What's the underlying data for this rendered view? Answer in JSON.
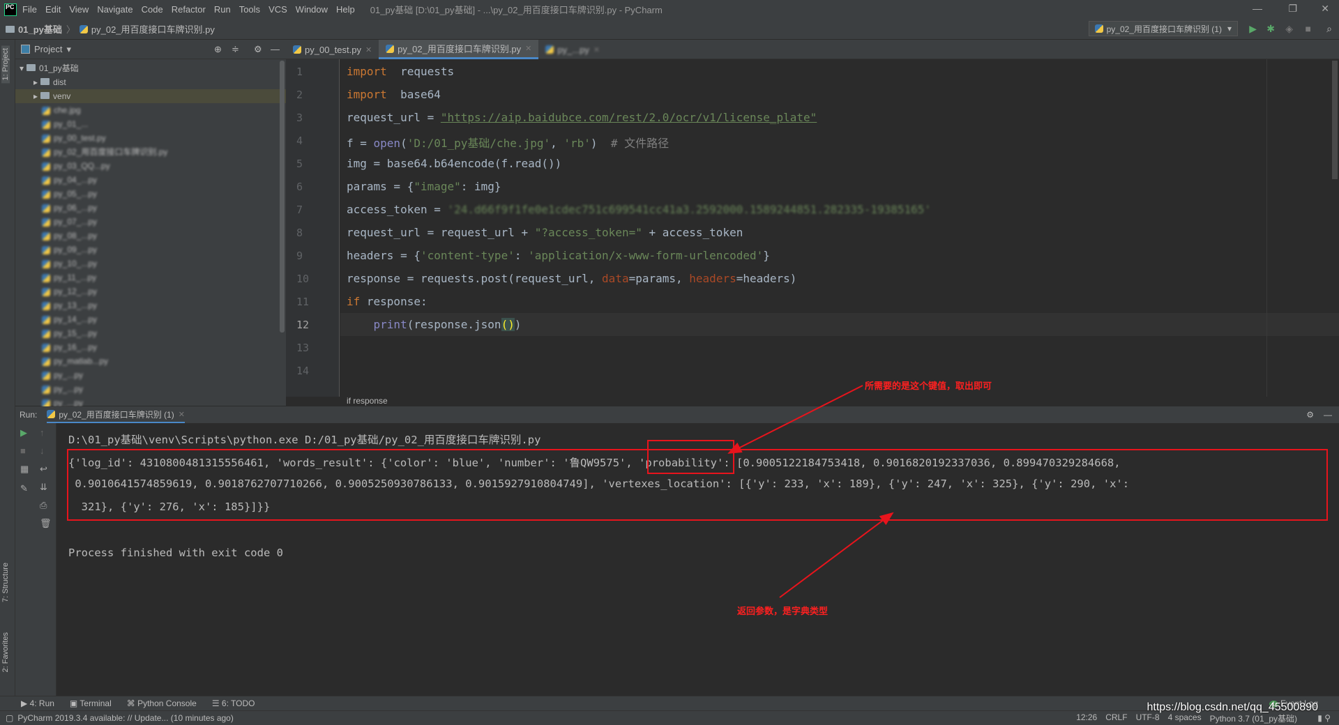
{
  "menubar": {
    "items": [
      "File",
      "Edit",
      "View",
      "Navigate",
      "Code",
      "Refactor",
      "Run",
      "Tools",
      "VCS",
      "Window",
      "Help"
    ],
    "window_title": "01_py基础 [D:\\01_py基础] - ...\\py_02_用百度接口车牌识别.py - PyCharm",
    "logo": "PC"
  },
  "navbar": {
    "project": "01_py基础",
    "file": "py_02_用百度接口车牌识别.py",
    "run_config": "py_02_用百度接口车牌识别 (1)"
  },
  "left_strip": {
    "project_tab": "1: Project",
    "structure_tab": "7: Structure",
    "favorites_tab": "2: Favorites"
  },
  "project": {
    "title": "Project",
    "items": [
      {
        "label": "01_py基础",
        "type": "folder",
        "depth": 0
      },
      {
        "label": "dist",
        "type": "folder",
        "depth": 1
      },
      {
        "label": "venv",
        "type": "folder",
        "depth": 1
      },
      {
        "label": "che.jpg",
        "type": "file",
        "depth": 1
      },
      {
        "label": "py_01_...",
        "type": "py",
        "depth": 1
      },
      {
        "label": "py_00_test.py",
        "type": "py",
        "depth": 1
      },
      {
        "label": "py_02_用百度接口车牌识别.py",
        "type": "py",
        "depth": 1
      },
      {
        "label": "py_03_QQ...py",
        "type": "py",
        "depth": 1
      },
      {
        "label": "py_04_...py",
        "type": "py",
        "depth": 1
      },
      {
        "label": "py_05_...py",
        "type": "py",
        "depth": 1
      },
      {
        "label": "py_06_...py",
        "type": "py",
        "depth": 1
      },
      {
        "label": "py_07_...py",
        "type": "py",
        "depth": 1
      },
      {
        "label": "py_08_...py",
        "type": "py",
        "depth": 1
      },
      {
        "label": "py_09_...py",
        "type": "py",
        "depth": 1
      },
      {
        "label": "py_10_...py",
        "type": "py",
        "depth": 1
      },
      {
        "label": "py_11_...py",
        "type": "py",
        "depth": 1
      },
      {
        "label": "py_12_...py",
        "type": "py",
        "depth": 1
      },
      {
        "label": "py_13_...py",
        "type": "py",
        "depth": 1
      },
      {
        "label": "py_14_...py",
        "type": "py",
        "depth": 1
      },
      {
        "label": "py_15_...py",
        "type": "py",
        "depth": 1
      },
      {
        "label": "py_16_...py",
        "type": "py",
        "depth": 1
      },
      {
        "label": "py_matlab...py",
        "type": "py",
        "depth": 1
      },
      {
        "label": "py_...py",
        "type": "py",
        "depth": 1
      },
      {
        "label": "py_...py",
        "type": "py",
        "depth": 1
      },
      {
        "label": "py_...py",
        "type": "py",
        "depth": 1
      }
    ]
  },
  "tabs": [
    {
      "label": "py_00_test.py",
      "active": false
    },
    {
      "label": "py_02_用百度接口车牌识别.py",
      "active": true
    },
    {
      "label": "py_...py",
      "active": false
    }
  ],
  "editor": {
    "line_numbers": [
      "1",
      "2",
      "3",
      "4",
      "5",
      "6",
      "7",
      "8",
      "9",
      "10",
      "11",
      "12",
      "13",
      "14"
    ],
    "current_line": 12,
    "breadcrumb": "if response",
    "lines": [
      [
        [
          "kw",
          "import"
        ],
        [
          "",
          "  requests"
        ]
      ],
      [
        [
          "kw",
          "import"
        ],
        [
          "",
          "  base64"
        ]
      ],
      [
        [
          "",
          "request_url = "
        ],
        [
          "url",
          "\"https://aip.baidubce.com/rest/2.0/ocr/v1/license_plate\""
        ]
      ],
      [
        [
          "",
          "f = "
        ],
        [
          "fn",
          "open"
        ],
        [
          "",
          "("
        ],
        [
          "str",
          "'D:/01_py基础/che.jpg'"
        ],
        [
          "",
          ", "
        ],
        [
          "str",
          "'rb'"
        ],
        [
          "",
          ")  "
        ],
        [
          "cm",
          "# 文件路径"
        ]
      ],
      [
        [
          "",
          "img = base64.b64encode(f.read())"
        ]
      ],
      [
        [
          "",
          "params = {"
        ],
        [
          "str",
          "\"image\""
        ],
        [
          "",
          ": img}"
        ]
      ],
      [
        [
          "",
          "access_token = "
        ],
        [
          "str blur",
          "'24.d66f9f1fe0e1cdec751c699541cc41a3.2592000.1589244851.282335-19385165'"
        ]
      ],
      [
        [
          "",
          "request_url = request_url + "
        ],
        [
          "str",
          "\"?access_token=\""
        ],
        [
          "",
          " + access_token"
        ]
      ],
      [
        [
          "",
          "headers = {"
        ],
        [
          "str",
          "'content-type'"
        ],
        [
          "",
          ": "
        ],
        [
          "str",
          "'application/x-www-form-urlencoded'"
        ],
        [
          "",
          "}"
        ]
      ],
      [
        [
          "",
          "response = requests.post(request_url, "
        ],
        [
          "par",
          "data"
        ],
        [
          "",
          "=params, "
        ],
        [
          "par",
          "headers"
        ],
        [
          "",
          "=headers)"
        ]
      ],
      [
        [
          "kw",
          "if"
        ],
        [
          "",
          " response:"
        ]
      ],
      [
        [
          "",
          "    "
        ],
        [
          "fn",
          "print"
        ],
        [
          "",
          "(response.json"
        ],
        [
          "hl",
          "()"
        ],
        [
          "",
          ")"
        ]
      ],
      [],
      []
    ]
  },
  "run": {
    "label": "Run:",
    "tab": "py_02_用百度接口车牌识别 (1)",
    "console": [
      "D:\\01_py基础\\venv\\Scripts\\python.exe D:/01_py基础/py_02_用百度接口车牌识别.py",
      "{'log_id': 4310800481315556461, 'words_result': {'color': 'blue', 'number': '鲁QW9575', 'probability': [0.9005122184753418, 0.9016820192337036, 0.899470329284668,",
      " 0.9010641574859619, 0.9018762707710266, 0.9005250930786133, 0.9015927910804749], 'vertexes_location': [{'y': 233, 'x': 189}, {'y': 247, 'x': 325}, {'y': 290, 'x':",
      "  321}, {'y': 276, 'x': 185}]}}",
      "Process finished with exit code 0"
    ]
  },
  "annotations": {
    "key_note": "所需要的是这个键值，取出即可",
    "return_note": "返回参数，是字典类型",
    "color": "#e8141c"
  },
  "bottom_tabs": [
    "4: Run",
    "Terminal",
    "Python Console",
    "6: TODO"
  ],
  "event_log": "Event Log",
  "status": {
    "message": "PyCharm 2019.3.4 available: // Update... (10 minutes ago)",
    "position": "12:26",
    "line_sep": "CRLF",
    "encoding": "UTF-8",
    "indent": "4 spaces",
    "interpreter": "Python 3.7 (01_py基础)",
    "watermark": "https://blog.csdn.net/qq_45500890"
  }
}
